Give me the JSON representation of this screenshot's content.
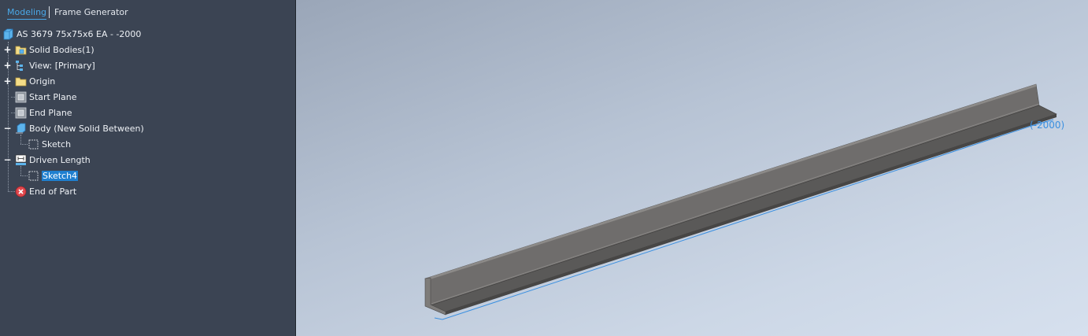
{
  "tabs": {
    "modeling": "Modeling",
    "frame_generator": "Frame Generator"
  },
  "tree": {
    "root": "AS 3679 75x75x6 EA - -2000",
    "solid_bodies": "Solid Bodies(1)",
    "view": "View: [Primary]",
    "origin": "Origin",
    "start_plane": "Start Plane",
    "end_plane": "End Plane",
    "body": "Body (New Solid Between)",
    "sketch": "Sketch",
    "driven_length": "Driven Length",
    "sketch4": "Sketch4",
    "end_of_part": "End of Part"
  },
  "viewport": {
    "dimension": "(-2000)"
  },
  "colors": {
    "panel": "#3b4453",
    "accent": "#4aa8e8",
    "selection": "#1f7fcf",
    "dimension": "#3a8fe0"
  }
}
